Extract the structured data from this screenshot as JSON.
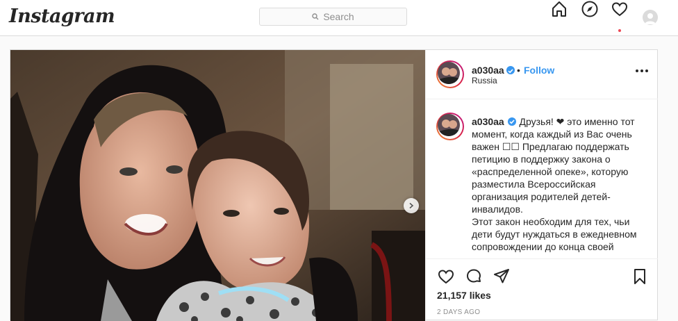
{
  "app": {
    "logo": "Instagram"
  },
  "search": {
    "placeholder": "Search"
  },
  "nav": {
    "icons": [
      "home-icon",
      "explore-icon",
      "activity-heart-icon",
      "profile-avatar-icon"
    ]
  },
  "post": {
    "username": "a030aa",
    "verified": true,
    "follow_label": "Follow",
    "separator": "•",
    "location": "Russia",
    "caption_username": "a030aa",
    "caption_text": "Друзья! ❤ это именно тот момент, когда каждый из Вас очень важен ☐☐ Предлагаю поддержать петицию в поддержку закона о «распределенной опеке», которую разместила Всероссийская организация родителей детей-инвалидов.",
    "caption_text2": "Этот закон необходим для тех, чьи дети будут нуждаться в ежедневном сопровождении до конца своей",
    "likes": "21,157 likes",
    "date": "2 DAYS AGO"
  },
  "colors": {
    "accent": "#3897f0",
    "border": "#dbdbdb",
    "notify": "#ed4956"
  }
}
